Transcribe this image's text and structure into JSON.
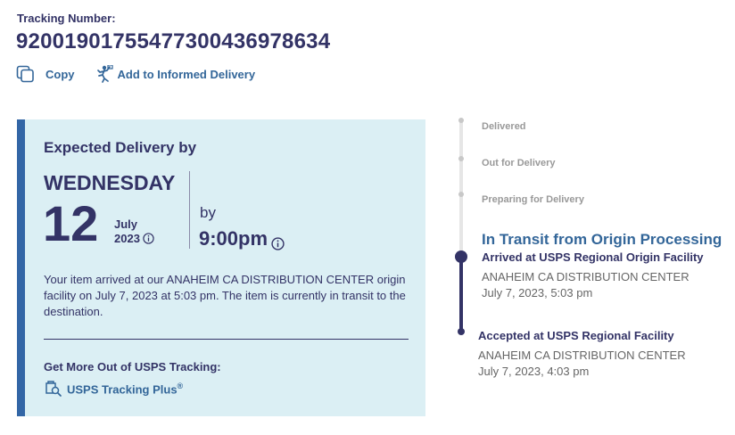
{
  "tracking": {
    "label": "Tracking Number:",
    "number": "92001901755477300436978634"
  },
  "actions": {
    "copy_label": "Copy",
    "informed_label": "Add to Informed Delivery"
  },
  "delivery": {
    "heading": "Expected Delivery by",
    "weekday": "WEDNESDAY",
    "day": "12",
    "month": "July",
    "year": "2023",
    "by_label": "by",
    "time": "9:00pm",
    "description": "Your item arrived at our ANAHEIM CA DISTRIBUTION CENTER origin facility on July 7, 2023 at 5:03 pm. The item is currently in transit to the destination.",
    "more_heading": "Get More Out of USPS Tracking:",
    "plus_label": "USPS Tracking Plus",
    "plus_mark": "®"
  },
  "timeline": {
    "pending": [
      "Delivered",
      "Out for Delivery",
      "Preparing for Delivery"
    ],
    "current_status": "In Transit from Origin Processing",
    "events": [
      {
        "title": "Arrived at USPS Regional Origin Facility",
        "location": "ANAHEIM CA DISTRIBUTION CENTER",
        "datetime": "July 7, 2023, 5:03 pm"
      },
      {
        "title": "Accepted at USPS Regional Facility",
        "location": "ANAHEIM CA DISTRIBUTION CENTER",
        "datetime": "July 7, 2023, 4:03 pm"
      }
    ]
  },
  "colors": {
    "navy": "#333366",
    "link_blue": "#336699",
    "card_bg": "#dbeff4",
    "card_accent": "#3366a6"
  },
  "icons": {
    "copy": "copy-icon",
    "informed": "informed-delivery-icon",
    "info": "info-icon",
    "plus": "tracking-plus-icon"
  }
}
